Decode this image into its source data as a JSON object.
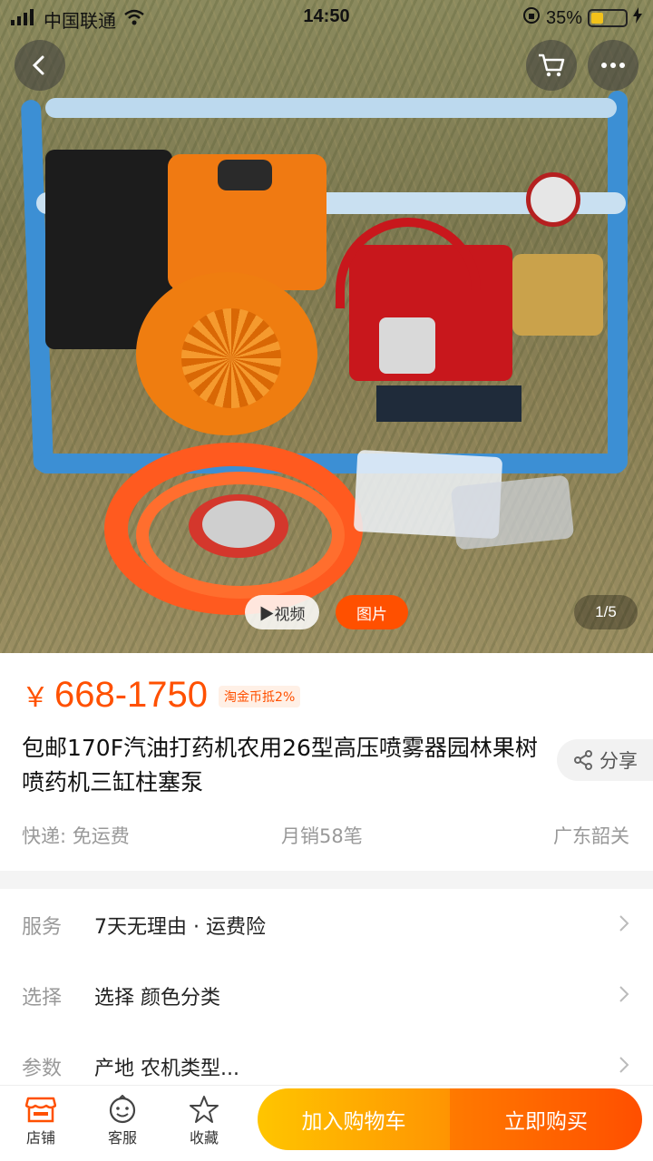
{
  "status_bar": {
    "carrier": "中国联通",
    "time": "14:50",
    "battery": "35%",
    "battery_level": 0.35
  },
  "gallery": {
    "video_label": "▶视频",
    "photo_label": "图片",
    "counter": "1/5"
  },
  "product": {
    "price_symbol": "￥",
    "price": "668-1750",
    "coin_tag": "淘金币抵2%",
    "title": "包邮170F汽油打药机农用26型高压喷雾器园林果树喷药机三缸柱塞泵",
    "share_label": "分享",
    "shipping": "快递: 免运费",
    "monthly_sales": "月销58笔",
    "location": "广东韶关"
  },
  "rows": [
    {
      "label": "服务",
      "value": "7天无理由 · 运费险"
    },
    {
      "label": "选择",
      "value": "选择  颜色分类"
    },
    {
      "label": "参数",
      "value": "产地  农机类型..."
    }
  ],
  "bottom_bar": {
    "store_label": "店铺",
    "service_label": "客服",
    "favorite_label": "收藏",
    "add_cart_label": "加入购物车",
    "buy_now_label": "立即购买"
  },
  "colors": {
    "accent": "#ff5000",
    "cart_gradient_start": "#ffc500",
    "cart_gradient_end": "#ff9402",
    "buy_gradient_start": "#ff7a00",
    "buy_gradient_end": "#ff4f00"
  }
}
